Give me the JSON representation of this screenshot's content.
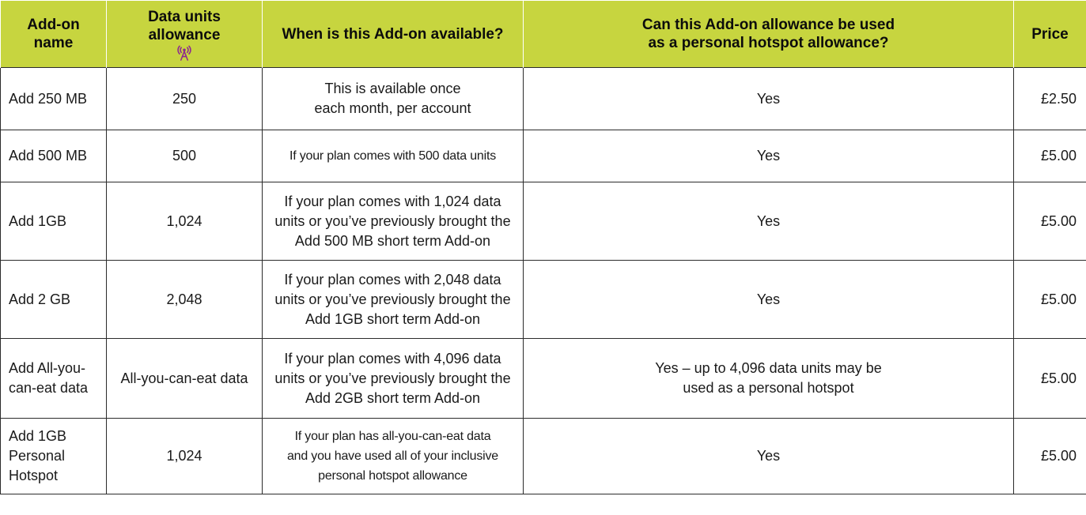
{
  "table": {
    "headers": {
      "name": [
        "Add-on",
        "name"
      ],
      "allowance": "Data units allowance",
      "availability": "When is this Add-on available?",
      "hotspot": [
        "Can this Add-on allowance be used",
        "as a personal hotspot allowance?"
      ],
      "price": "Price"
    },
    "icons": {
      "allowance_header": "signal-tower-icon"
    },
    "rows": [
      {
        "name": [
          "Add 250 MB"
        ],
        "allowance": "250",
        "availability": [
          "This is available once",
          "each month, per account"
        ],
        "hotspot": [
          "Yes"
        ],
        "price": "£2.50"
      },
      {
        "name": [
          "Add 500 MB"
        ],
        "allowance": "500",
        "availability": [
          "If your plan comes with 500 data units"
        ],
        "hotspot": [
          "Yes"
        ],
        "price": "£5.00"
      },
      {
        "name": [
          "Add 1GB"
        ],
        "allowance": "1,024",
        "availability": [
          "If your plan comes with 1,024 data",
          "units or you’ve previously brought the",
          "Add 500 MB short term Add-on"
        ],
        "hotspot": [
          "Yes"
        ],
        "price": "£5.00"
      },
      {
        "name": [
          "Add 2 GB"
        ],
        "allowance": "2,048",
        "availability": [
          "If your plan comes with 2,048 data",
          "units or you’ve previously brought the",
          "Add 1GB short term Add-on"
        ],
        "hotspot": [
          "Yes"
        ],
        "price": "£5.00"
      },
      {
        "name": [
          "Add All-you-",
          "can-eat data"
        ],
        "allowance": "All-you-can-eat data",
        "availability": [
          "If your plan comes with 4,096 data",
          "units or you’ve previously brought the",
          "Add 2GB short term Add-on"
        ],
        "hotspot": [
          "Yes – up to 4,096 data units may be",
          "used as a personal hotspot"
        ],
        "price": "£5.00"
      },
      {
        "name": [
          "Add 1GB",
          "Personal",
          "Hotspot"
        ],
        "allowance": "1,024",
        "availability": [
          "If your plan has all-you-can-eat data",
          "and you have used all of your inclusive",
          "personal hotspot allowance"
        ],
        "hotspot": [
          "Yes"
        ],
        "price": "£5.00"
      }
    ]
  },
  "colors": {
    "header_bg": "#c7d53f",
    "icon_purple": "#8e2a8e",
    "border": "#2b2b2b"
  }
}
